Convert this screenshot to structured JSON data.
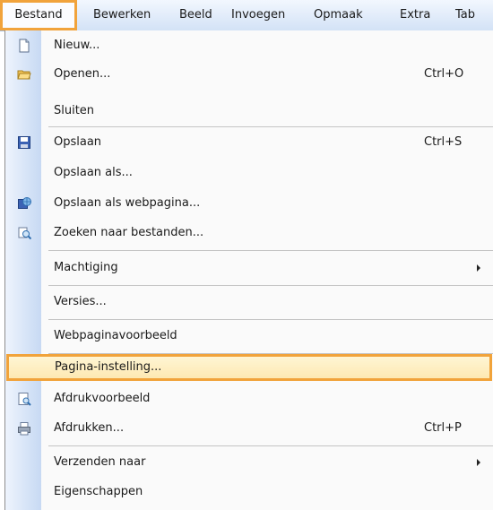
{
  "menubar": {
    "items": [
      {
        "label": "Bestand",
        "open": true
      },
      {
        "label": "Bewerken"
      },
      {
        "label": "Beeld"
      },
      {
        "label": "Invoegen"
      },
      {
        "label": "Opmaak"
      },
      {
        "label": "Extra"
      },
      {
        "label": "Tab"
      }
    ]
  },
  "menu": {
    "items": [
      {
        "label": "Nieuw...",
        "shortcut": "",
        "icon": "new-document-icon"
      },
      {
        "label": "Openen...",
        "shortcut": "Ctrl+O",
        "icon": "open-folder-icon"
      },
      {
        "label": "Sluiten",
        "shortcut": ""
      },
      {
        "label": "Opslaan",
        "shortcut": "Ctrl+S",
        "icon": "save-disk-icon"
      },
      {
        "label": "Opslaan als...",
        "shortcut": ""
      },
      {
        "label": "Opslaan als webpagina...",
        "shortcut": "",
        "icon": "save-web-icon"
      },
      {
        "label": "Zoeken naar bestanden...",
        "shortcut": "",
        "icon": "search-files-icon"
      },
      {
        "label": "Machtiging",
        "shortcut": "",
        "submenu": true
      },
      {
        "label": "Versies...",
        "shortcut": ""
      },
      {
        "label": "Webpaginavoorbeeld",
        "shortcut": ""
      },
      {
        "label": "Pagina-instelling...",
        "shortcut": "",
        "highlighted": true
      },
      {
        "label": "Afdrukvoorbeeld",
        "shortcut": "",
        "icon": "print-preview-icon"
      },
      {
        "label": "Afdrukken...",
        "shortcut": "Ctrl+P",
        "icon": "printer-icon"
      },
      {
        "label": "Verzenden naar",
        "shortcut": "",
        "submenu": true
      },
      {
        "label": "Eigenschappen",
        "shortcut": ""
      }
    ]
  },
  "colors": {
    "highlight_border": "#f1a33b",
    "highlight_fill": "#fde7ae",
    "gutter": "#c7d9f3",
    "menubar": "#d3e2f6"
  }
}
